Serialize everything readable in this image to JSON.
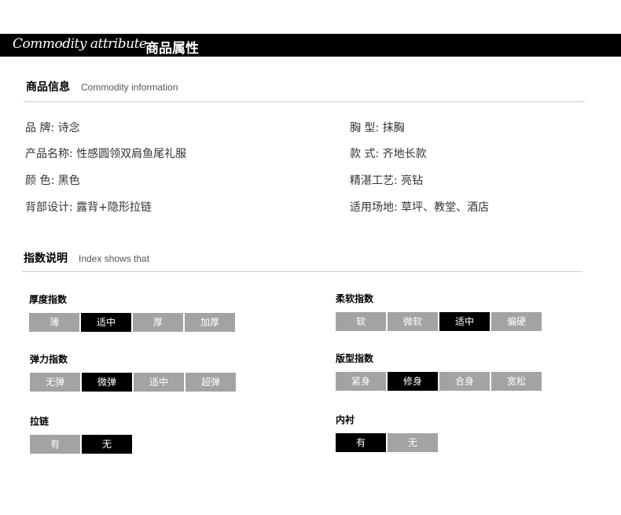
{
  "banner": {
    "en": "Commodity attribute",
    "cn": "商品属性"
  },
  "info_section": {
    "title_cn": "商品信息",
    "title_en": "Commodity information",
    "left": [
      "品 牌: 诗念",
      "产品名称: 性感圆领双肩鱼尾礼服",
      "颜 色: 黑色",
      "背部设计: 露背+隐形拉链"
    ],
    "right": [
      "胸 型: 抹胸",
      "款 式: 齐地长款",
      "精湛工艺: 亮钻",
      "适用场地: 草坪、教堂、酒店"
    ]
  },
  "index_section": {
    "title_cn": "指数说明",
    "title_en": "Index shows that",
    "groups": [
      {
        "label": "厚度指数",
        "options": [
          "薄",
          "适中",
          "厚",
          "加厚"
        ],
        "selected": 1
      },
      {
        "label": "柔软指数",
        "options": [
          "软",
          "微软",
          "适中",
          "偏硬"
        ],
        "selected": 2
      },
      {
        "label": "弹力指数",
        "options": [
          "无弹",
          "微弹",
          "适中",
          "超弹"
        ],
        "selected": 1
      },
      {
        "label": "版型指数",
        "options": [
          "紧身",
          "修身",
          "合身",
          "宽松"
        ],
        "selected": 1
      },
      {
        "label": "拉链",
        "options": [
          "有",
          "无"
        ],
        "selected": 1
      },
      {
        "label": "内衬",
        "options": [
          "有",
          "无"
        ],
        "selected": 0
      }
    ]
  },
  "colors": {
    "active": "#000000",
    "inactive": "#a3a3a3",
    "banner": "#000000"
  }
}
